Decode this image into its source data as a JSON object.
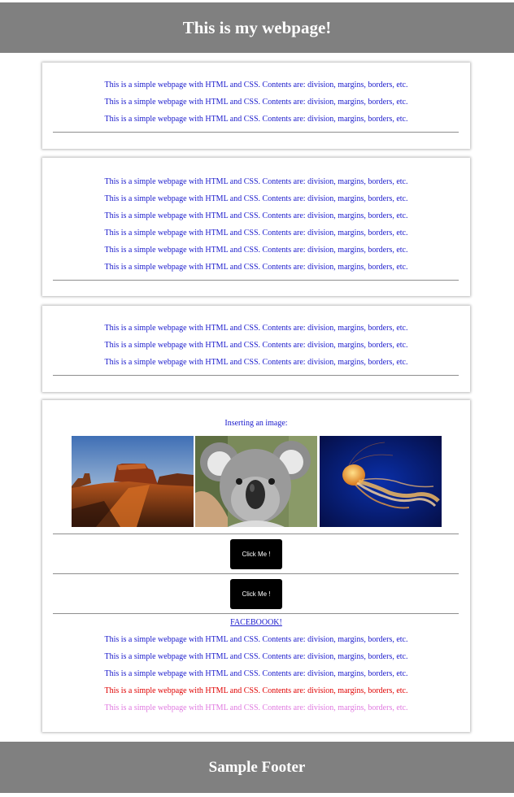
{
  "header": {
    "title": "This is my webpage!"
  },
  "paragraph_text": "This is a simple webpage with HTML and CSS. Contents are: division, margins, borders, etc.",
  "card4": {
    "image_heading": "Inserting an image:",
    "images": [
      {
        "name": "desert-mesa-image"
      },
      {
        "name": "koala-image"
      },
      {
        "name": "jellyfish-image"
      }
    ],
    "button1_label": "Click Me !",
    "button2_label": "Click Me !",
    "link_text": "FACEBOOOK!"
  },
  "footer": {
    "title": "Sample Footer"
  },
  "colors": {
    "header_bg": "#808080",
    "text_blue": "#1a1acc",
    "text_red": "#e00000",
    "text_pink": "#e07ae0",
    "button_bg": "#000000"
  }
}
